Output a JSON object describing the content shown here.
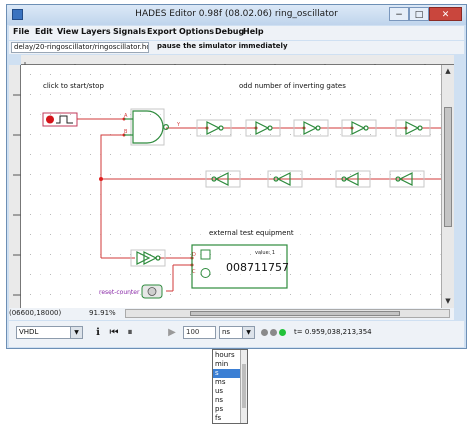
{
  "window": {
    "title": "HADES Editor 0.98f (08.02.06)  ring_oscillator",
    "min": "−",
    "max": "□",
    "close": "✕"
  },
  "menu": [
    "File",
    "Edit",
    "View",
    "Layers",
    "Signals",
    "Export",
    "Options",
    "Debug",
    "Help"
  ],
  "pathbar": {
    "file": "delay/20-ringoscillator/ringoscillator.hds",
    "message": "pause the simulator immediately"
  },
  "canvas": {
    "label_start": "click to start/stop",
    "label_gates": "odd number of inverting gates",
    "label_external": "external test equipment",
    "counter_label": "value: 1",
    "counter_value": "008711757",
    "reset_label": "reset-counter",
    "pin_a": "A",
    "pin_b": "B",
    "pin_y": "Y",
    "pin_d": "D",
    "pin_c": "C"
  },
  "status": {
    "coords": "(06600,18000)",
    "zoom": "91.91%"
  },
  "toolbar": {
    "language": "VHDL",
    "steps": "100",
    "unit": "ns",
    "sim_time": "t= 0.959,038,213,354",
    "led_colors": [
      "#8a8a8a",
      "#8a8a8a",
      "#22c23a"
    ],
    "icons": {
      "info": "ℹ",
      "rewind": "⏮",
      "pause": "⏸",
      "play": "▶"
    }
  },
  "dropdown": {
    "options": [
      "hours",
      "min",
      "s",
      "ms",
      "us",
      "ns",
      "ps",
      "fs"
    ],
    "selected": "s"
  }
}
